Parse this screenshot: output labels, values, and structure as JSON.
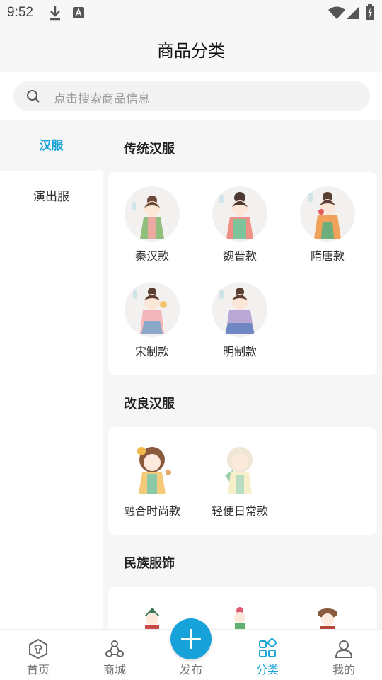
{
  "status_bar": {
    "time": "9:52"
  },
  "header": {
    "title": "商品分类"
  },
  "search": {
    "placeholder": "点击搜索商品信息"
  },
  "sidebar": {
    "items": [
      {
        "label": "汉服",
        "active": true
      },
      {
        "label": "演出服",
        "active": false
      }
    ]
  },
  "sections": [
    {
      "title": "传统汉服",
      "items": [
        {
          "label": "秦汉款"
        },
        {
          "label": "魏晋款"
        },
        {
          "label": "隋唐款"
        },
        {
          "label": "宋制款"
        },
        {
          "label": "明制款"
        }
      ]
    },
    {
      "title": "改良汉服",
      "items": [
        {
          "label": "融合时尚款"
        },
        {
          "label": "轻便日常款"
        }
      ]
    },
    {
      "title": "民族服饰",
      "items": []
    }
  ],
  "bottom_nav": {
    "items": [
      {
        "label": "首页",
        "icon": "home-icon"
      },
      {
        "label": "商城",
        "icon": "shop-icon"
      },
      {
        "label": "发布",
        "icon": "plus-icon"
      },
      {
        "label": "分类",
        "icon": "category-icon",
        "active": true
      },
      {
        "label": "我的",
        "icon": "profile-icon"
      }
    ]
  },
  "colors": {
    "accent": "#1aa4d8",
    "background": "#f6f6f6"
  }
}
